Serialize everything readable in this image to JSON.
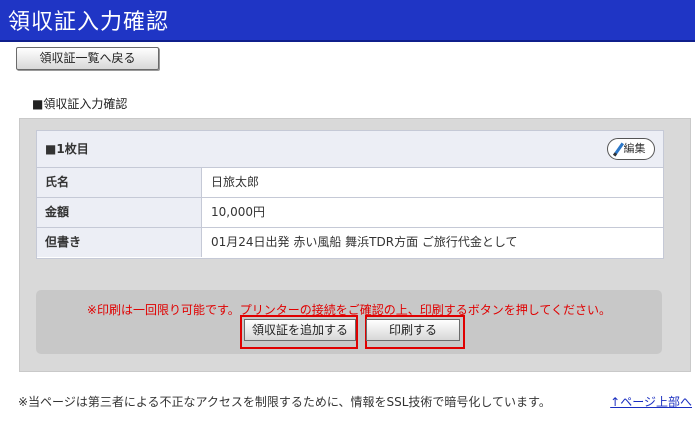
{
  "header": {
    "title": "領収証入力確認"
  },
  "back_button": {
    "label": "領収証一覧へ戻る"
  },
  "section": {
    "label": "■領収証入力確認"
  },
  "card": {
    "title": "■1枚目",
    "edit_label": "編集",
    "rows": [
      {
        "key": "氏名",
        "value": "日旅太郎"
      },
      {
        "key": "金額",
        "value": "10,000円"
      },
      {
        "key": "但書き",
        "value": "01月24日出発 赤い風船 舞浜TDR方面 ご旅行代金として"
      }
    ]
  },
  "notice": {
    "text": "※印刷は一回限り可能です。プリンターの接続をご確認の上、印刷するボタンを押してください。"
  },
  "buttons": {
    "add": "領収証を追加する",
    "print": "印刷する"
  },
  "footer": {
    "note": "※当ページは第三者による不正なアクセスを制限するために、情報をSSL技術で暗号化しています。",
    "top_link": "↑ページ上部へ"
  },
  "colors": {
    "header": "#1f35c5",
    "highlight": "#e00000",
    "notice_text": "#e00000"
  }
}
